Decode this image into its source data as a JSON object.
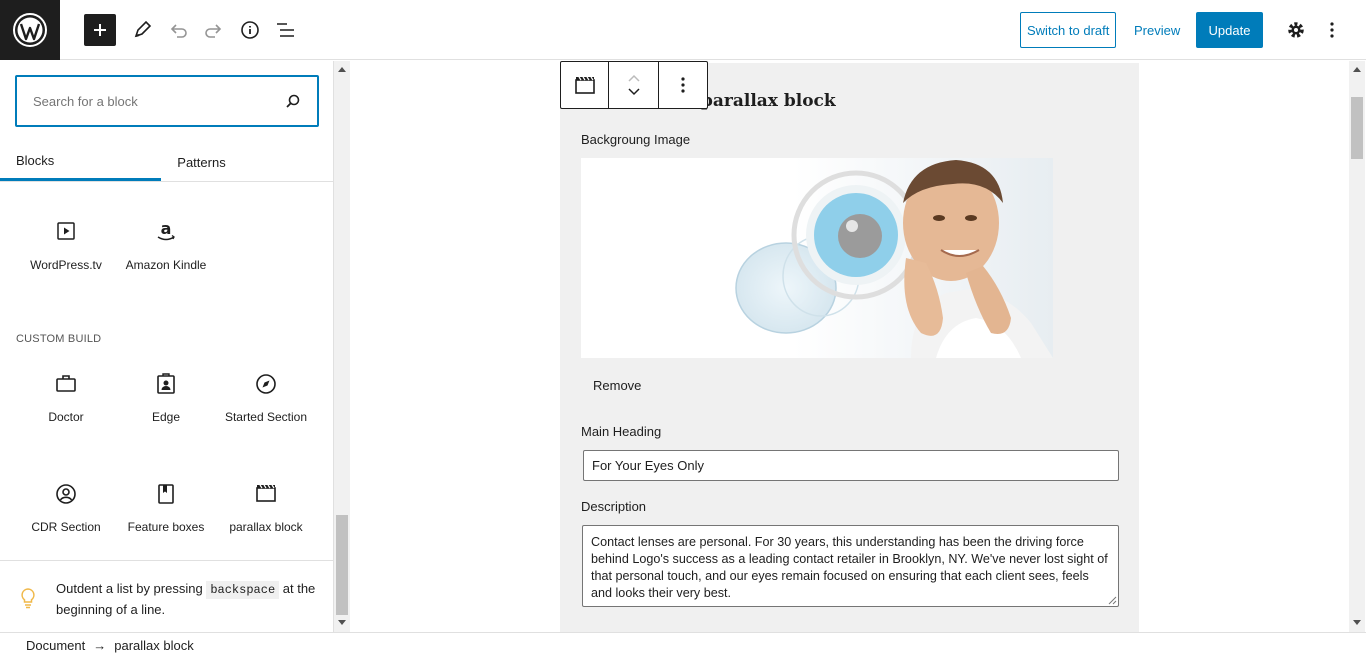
{
  "toolbar": {
    "switch_draft": "Switch to draft",
    "preview": "Preview",
    "update": "Update"
  },
  "sidebar": {
    "search_placeholder": "Search for a block",
    "tabs": [
      "Blocks",
      "Patterns"
    ],
    "embeds": [
      {
        "label": "WordPress.tv",
        "icon": "video-icon"
      },
      {
        "label": "Amazon Kindle",
        "icon": "amazon-icon"
      }
    ],
    "category": "CUSTOM BUILD",
    "custom_blocks": [
      {
        "label": "Doctor",
        "icon": "briefcase-icon"
      },
      {
        "label": "Edge",
        "icon": "id-card-icon"
      },
      {
        "label": "Started Section",
        "icon": "compass-icon"
      },
      {
        "label": "CDR Section",
        "icon": "user-circle-icon"
      },
      {
        "label": "Feature boxes",
        "icon": "book-icon"
      },
      {
        "label": "parallax block",
        "icon": "film-icon"
      }
    ],
    "tip": {
      "before": "Outdent a list by pressing",
      "key": "backspace",
      "after": "at the beginning of a line."
    }
  },
  "editor": {
    "block_title": "parallax block",
    "bg_label": "Backgroung Image",
    "remove": "Remove",
    "heading_label": "Main Heading",
    "heading_value": "For Your Eyes Only",
    "description_label": "Description",
    "description_value": "Contact lenses are personal. For 30 years, this understanding has been the driving force behind Logo's success as a leading contact retailer in Brooklyn, NY. We've never lost sight of that personal touch, and our eyes remain focused on ensuring that each client sees, feels and looks their very best."
  },
  "breadcrumb": {
    "root": "Document",
    "separator": "→",
    "current": "parallax block"
  },
  "colors": {
    "accent": "#007cba",
    "dark": "#1e1e1e",
    "card_bg": "#f0f0f0"
  }
}
